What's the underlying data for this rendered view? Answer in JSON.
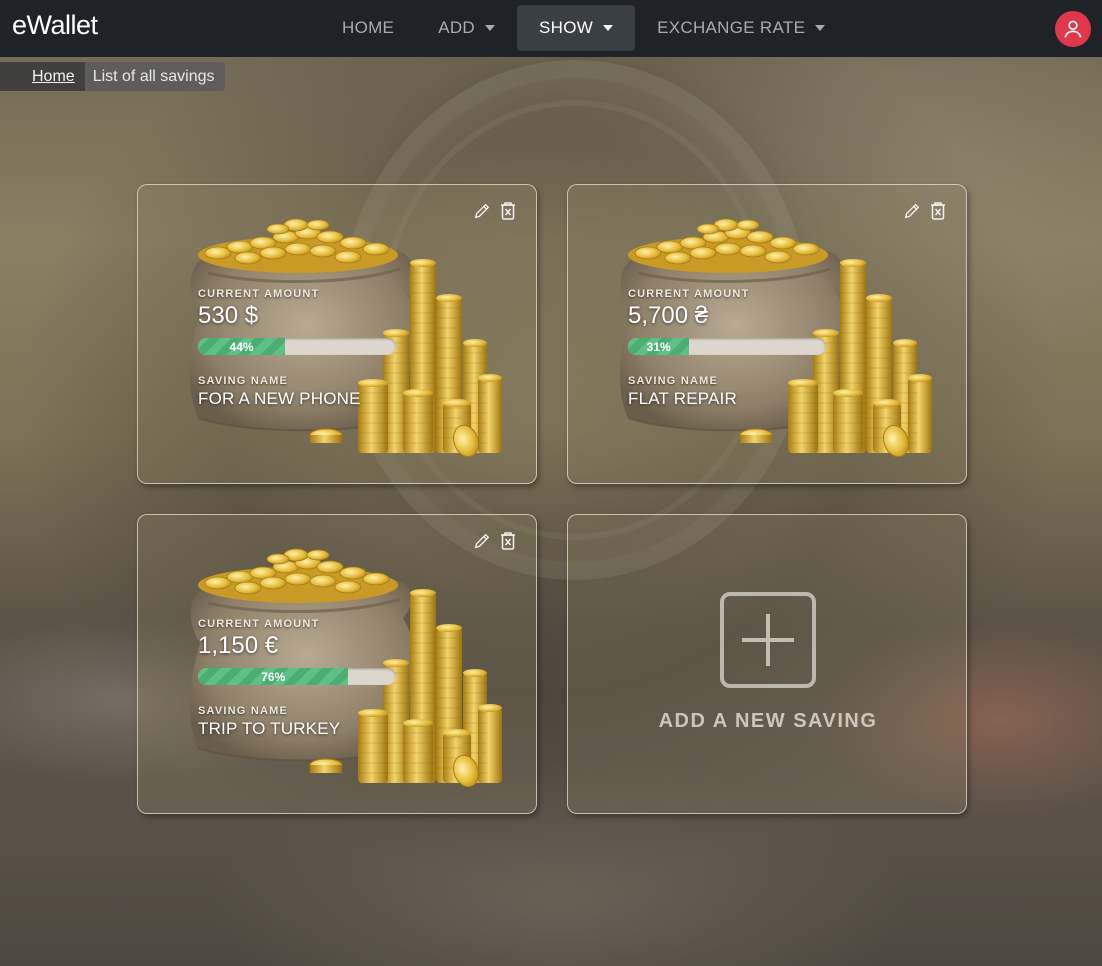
{
  "brand": "eWallet",
  "nav": {
    "items": [
      {
        "label": "HOME",
        "dropdown": false,
        "active": false
      },
      {
        "label": "ADD",
        "dropdown": true,
        "active": false
      },
      {
        "label": "SHOW",
        "dropdown": true,
        "active": true
      },
      {
        "label": "EXCHANGE RATE",
        "dropdown": true,
        "active": false
      }
    ],
    "user_icon": "user-icon"
  },
  "breadcrumb": {
    "home": "Home",
    "current": "List of all savings"
  },
  "savings": [
    {
      "amount_label": "CURRENT AMOUNT",
      "amount": "530 $",
      "progress": 44,
      "progress_label": "44%",
      "name_label": "SAVING NAME",
      "name": "FOR A NEW PHONE"
    },
    {
      "amount_label": "CURRENT AMOUNT",
      "amount": "5,700 ₴",
      "progress": 31,
      "progress_label": "31%",
      "name_label": "SAVING NAME",
      "name": "FLAT REPAIR"
    },
    {
      "amount_label": "CURRENT AMOUNT",
      "amount": "1,150 €",
      "progress": 76,
      "progress_label": "76%",
      "name_label": "SAVING NAME",
      "name": "TRIP TO TURKEY"
    }
  ],
  "add_saving": {
    "label": "ADD A NEW SAVING",
    "icon": "plus-icon"
  },
  "colors": {
    "navbar": "#1f2226",
    "user_avatar": "#e0384a",
    "progress": "#5fbf87"
  }
}
